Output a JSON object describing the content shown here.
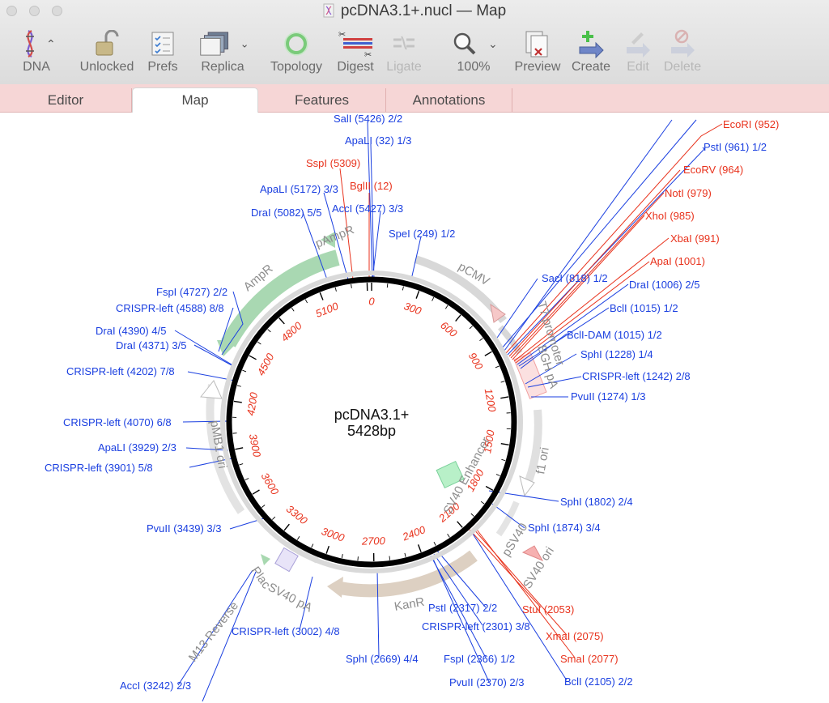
{
  "window": {
    "title": "pcDNA3.1+.nucl — Map"
  },
  "toolbar": {
    "items": [
      {
        "label": "DNA",
        "icon": "dna-helix-icon",
        "enabled": true
      },
      {
        "label": "Unlocked",
        "icon": "padlock-open-icon",
        "enabled": true
      },
      {
        "label": "Prefs",
        "icon": "checklist-icon",
        "enabled": true
      },
      {
        "label": "Replica",
        "icon": "stacked-windows-icon",
        "enabled": true
      },
      {
        "label": "Topology",
        "icon": "circle-ring-icon",
        "enabled": true
      },
      {
        "label": "Digest",
        "icon": "scissors-dna-icon",
        "enabled": true
      },
      {
        "label": "Ligate",
        "icon": "ligate-icon",
        "enabled": false
      },
      {
        "label": "100%",
        "icon": "magnifier-icon",
        "enabled": true
      },
      {
        "label": "Preview",
        "icon": "preview-icon",
        "enabled": true
      },
      {
        "label": "Create",
        "icon": "plus-arrow-icon",
        "enabled": true
      },
      {
        "label": "Edit",
        "icon": "pencil-arrow-icon",
        "enabled": false
      },
      {
        "label": "Delete",
        "icon": "delete-arrow-icon",
        "enabled": false
      }
    ]
  },
  "tabs": [
    {
      "label": "Editor",
      "active": false
    },
    {
      "label": "Map",
      "active": true
    },
    {
      "label": "Features",
      "active": false
    },
    {
      "label": "Annotations",
      "active": false
    }
  ],
  "plasmid": {
    "name": "pcDNA3.1+",
    "length_label": "5428bp",
    "length": 5428,
    "ticks": [
      0,
      300,
      600,
      900,
      1200,
      1500,
      1800,
      2100,
      2400,
      2700,
      3000,
      3300,
      3600,
      3900,
      4200,
      4500,
      4800,
      5100
    ]
  },
  "features": [
    {
      "label": "AmpR",
      "color": "#a8d8b0"
    },
    {
      "label": "pAmpR",
      "color": "#a8d8b0"
    },
    {
      "label": "pCMV",
      "color": "#cfcfcf"
    },
    {
      "label": "T7 promoter",
      "color": "#cfcfcf"
    },
    {
      "label": "BGH pA",
      "color": "#f4b8b8"
    },
    {
      "label": "f1 ori",
      "color": "#cfcfcf"
    },
    {
      "label": "SV40 Enhancer",
      "color": "#a8e8b8"
    },
    {
      "label": "pSV40",
      "color": "#cfcfcf"
    },
    {
      "label": "SV40 ori",
      "color": "#f5b5b5"
    },
    {
      "label": "KanR",
      "color": "#dccfc0"
    },
    {
      "label": "SV40 pA",
      "color": "#cfcfcf"
    },
    {
      "label": "Plac",
      "color": "#cfcfcf"
    },
    {
      "label": "M13 Reverse",
      "color": "#cfcfcf"
    },
    {
      "label": "pMB1 ori",
      "color": "#cfcfcf"
    }
  ],
  "sites": [
    {
      "label": "SalI (5426) 2/2",
      "color": "blue"
    },
    {
      "label": "ApaLI (32) 1/3",
      "color": "blue"
    },
    {
      "label": "SspI (5309)",
      "color": "red"
    },
    {
      "label": "BglII (12)",
      "color": "red"
    },
    {
      "label": "ApaLI (5172) 3/3",
      "color": "blue"
    },
    {
      "label": "AccI (5427) 3/3",
      "color": "blue"
    },
    {
      "label": "DraI (5082) 5/5",
      "color": "blue"
    },
    {
      "label": "SpeI (249) 1/2",
      "color": "blue"
    },
    {
      "label": "EcoRI (952)",
      "color": "red"
    },
    {
      "label": "PstI (961) 1/2",
      "color": "blue"
    },
    {
      "label": "EcoRV (964)",
      "color": "red"
    },
    {
      "label": "NotI (979)",
      "color": "red"
    },
    {
      "label": "XhoI (985)",
      "color": "red"
    },
    {
      "label": "XbaI (991)",
      "color": "red"
    },
    {
      "label": "ApaI (1001)",
      "color": "red"
    },
    {
      "label": "SacI (818) 1/2",
      "color": "blue"
    },
    {
      "label": "DraI (1006) 2/5",
      "color": "blue"
    },
    {
      "label": "BclI (1015) 1/2",
      "color": "blue"
    },
    {
      "label": "BclI-DAM (1015) 1/2",
      "color": "blue"
    },
    {
      "label": "SphI (1228) 1/4",
      "color": "blue"
    },
    {
      "label": "CRISPR-left (1242) 2/8",
      "color": "blue"
    },
    {
      "label": "PvuII (1274) 1/3",
      "color": "blue"
    },
    {
      "label": "FspI (4727) 2/2",
      "color": "blue"
    },
    {
      "label": "CRISPR-left (4588) 8/8",
      "color": "blue"
    },
    {
      "label": "DraI (4390) 4/5",
      "color": "blue"
    },
    {
      "label": "DraI (4371) 3/5",
      "color": "blue"
    },
    {
      "label": "CRISPR-left (4202) 7/8",
      "color": "blue"
    },
    {
      "label": "CRISPR-left (4070) 6/8",
      "color": "blue"
    },
    {
      "label": "ApaLI (3929) 2/3",
      "color": "blue"
    },
    {
      "label": "CRISPR-left (3901) 5/8",
      "color": "blue"
    },
    {
      "label": "PvuII (3439) 3/3",
      "color": "blue"
    },
    {
      "label": "SphI (1802) 2/4",
      "color": "blue"
    },
    {
      "label": "SphI (1874) 3/4",
      "color": "blue"
    },
    {
      "label": "PstI (2317) 2/2",
      "color": "blue"
    },
    {
      "label": "CRISPR-left (2301) 3/8",
      "color": "blue"
    },
    {
      "label": "StuI (2053)",
      "color": "red"
    },
    {
      "label": "XmaI (2075)",
      "color": "red"
    },
    {
      "label": "SmaI (2077)",
      "color": "red"
    },
    {
      "label": "CRISPR-left (3002) 4/8",
      "color": "blue"
    },
    {
      "label": "SphI (2669) 4/4",
      "color": "blue"
    },
    {
      "label": "FspI (2366) 1/2",
      "color": "blue"
    },
    {
      "label": "PvuII (2370) 2/3",
      "color": "blue"
    },
    {
      "label": "BclI (2105) 2/2",
      "color": "blue"
    },
    {
      "label": "AccI (3242) 2/3",
      "color": "blue"
    }
  ],
  "colors": {
    "site_blue": "#1a3fe0",
    "site_red": "#e8321c",
    "tick_red": "#e8321c",
    "tab_bar": "#f6d6d6"
  }
}
